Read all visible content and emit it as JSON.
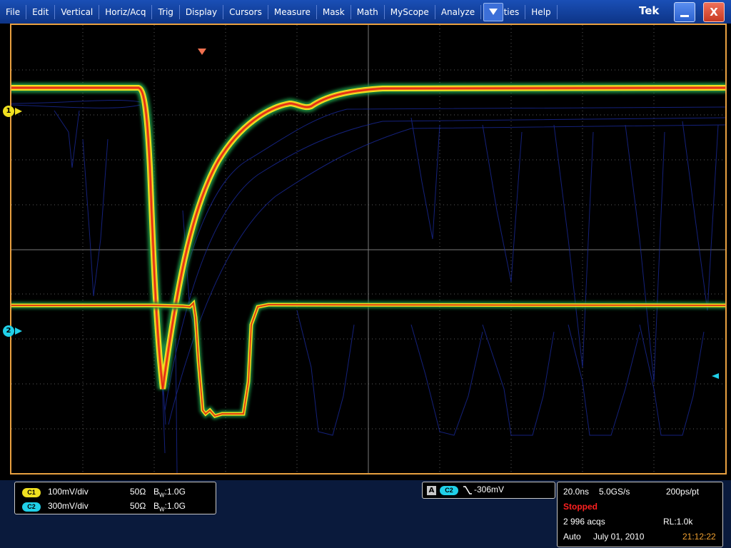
{
  "menu": {
    "items": [
      "File",
      "Edit",
      "Vertical",
      "Horiz/Acq",
      "Trig",
      "Display",
      "Cursors",
      "Measure",
      "Mask",
      "Math",
      "MyScope",
      "Analyze",
      "Utilities",
      "Help"
    ],
    "dropdown_icon": "triangle-down-icon"
  },
  "titlebar": {
    "logo": "Tek",
    "minimize_icon": "minimize-icon",
    "close_label": "X"
  },
  "channels": [
    {
      "id": "1",
      "badge": "C1",
      "scale": "100mV/div",
      "impedance": "50Ω",
      "bw_prefix": "B",
      "bw_sub": "W",
      "bw_value": ":1.0G",
      "color": "#f0e020"
    },
    {
      "id": "2",
      "badge": "C2",
      "scale": "300mV/div",
      "impedance": "50Ω",
      "bw_prefix": "B",
      "bw_sub": "W",
      "bw_value": ":1.0G",
      "color": "#20d0e8"
    }
  ],
  "trigger": {
    "mode_letter": "A",
    "source": "C2",
    "slope_icon": "falling-edge-icon",
    "level": "-306mV"
  },
  "horizontal": {
    "scale": "20.0ns",
    "sample_rate": "5.0GS/s",
    "resolution": "200ps/pt",
    "state": "Stopped",
    "acqs": "2 996 acqs",
    "record_length": "RL:1.0k",
    "trigger_mode": "Auto",
    "date": "July 01, 2010",
    "time": "21:12:22"
  },
  "colors": {
    "graticule_frame": "#e8a040",
    "stopped": "#ff2020",
    "time": "#f0a030"
  }
}
